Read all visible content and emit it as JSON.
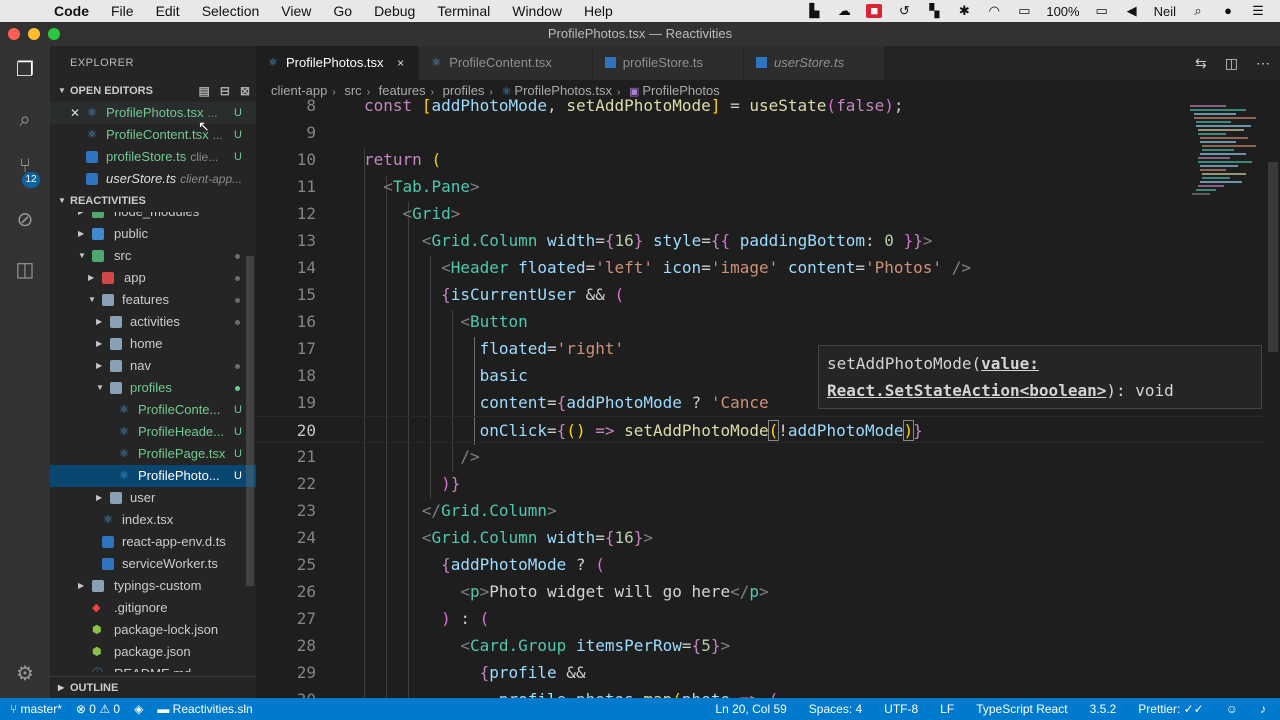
{
  "menubar": {
    "app": "Code",
    "items": [
      "File",
      "Edit",
      "Selection",
      "View",
      "Go",
      "Debug",
      "Terminal",
      "Window",
      "Help"
    ],
    "battery": "100%",
    "user": "Neil"
  },
  "window": {
    "title": "ProfilePhotos.tsx — Reactivities"
  },
  "activity": {
    "badge": "12"
  },
  "explorer": {
    "title": "EXPLORER",
    "open_editors_label": "OPEN EDITORS",
    "open_editors": [
      {
        "name": "ProfilePhotos.tsx",
        "hint": "...",
        "status": "U"
      },
      {
        "name": "ProfileContent.tsx",
        "hint": "...",
        "status": "U"
      },
      {
        "name": "profileStore.ts",
        "hint": "clie...",
        "status": "U"
      },
      {
        "name": "userStore.ts",
        "hint": "client-app..."
      }
    ],
    "project_label": "REACTIVITIES",
    "tree": {
      "node_modules": "node_modules",
      "public": "public",
      "src": "src",
      "app": "app",
      "features": "features",
      "activities": "activities",
      "home": "home",
      "nav": "nav",
      "profiles": "profiles",
      "profile_content": "ProfileConte...",
      "profile_header": "ProfileHeade...",
      "profile_page": "ProfilePage.tsx",
      "profile_photos": "ProfilePhoto...",
      "user": "user",
      "index": "index.tsx",
      "react_env": "react-app-env.d.ts",
      "service_worker": "serviceWorker.ts",
      "typings": "typings-custom",
      "gitignore": ".gitignore",
      "package_lock": "package-lock.json",
      "package": "package.json",
      "readme": "README.md",
      "u": "U"
    },
    "outline_label": "OUTLINE"
  },
  "tabs": [
    {
      "label": "ProfilePhotos.tsx",
      "close": "×"
    },
    {
      "label": "ProfileContent.tsx"
    },
    {
      "label": "profileStore.ts"
    },
    {
      "label": "userStore.ts"
    }
  ],
  "breadcrumb": [
    "client-app",
    "src",
    "features",
    "profiles",
    "ProfilePhotos.tsx",
    "ProfilePhotos"
  ],
  "editor": {
    "line_numbers": [
      "8",
      "9",
      "10",
      "11",
      "12",
      "13",
      "14",
      "15",
      "16",
      "17",
      "18",
      "19",
      "20",
      "21",
      "22",
      "23",
      "24",
      "25",
      "26",
      "27",
      "28",
      "29",
      "30"
    ],
    "tooltip_fn": "setAddPhotoMode(",
    "tooltip_param": "value:",
    "tooltip_type": "React.SetStateAction<boolean>",
    "tooltip_ret": "): void"
  },
  "statusbar": {
    "branch": "master*",
    "errors": "0",
    "warnings": "0",
    "solution": "Reactivities.sln",
    "position": "Ln 20, Col 59",
    "spaces": "Spaces: 4",
    "encoding": "UTF-8",
    "eol": "LF",
    "language": "TypeScript React",
    "version": "3.5.2",
    "prettier": "Prettier: ✓✓"
  },
  "colors": {
    "statusbar": "#007acc",
    "selection": "#094771",
    "accent_green": "#73c991"
  }
}
